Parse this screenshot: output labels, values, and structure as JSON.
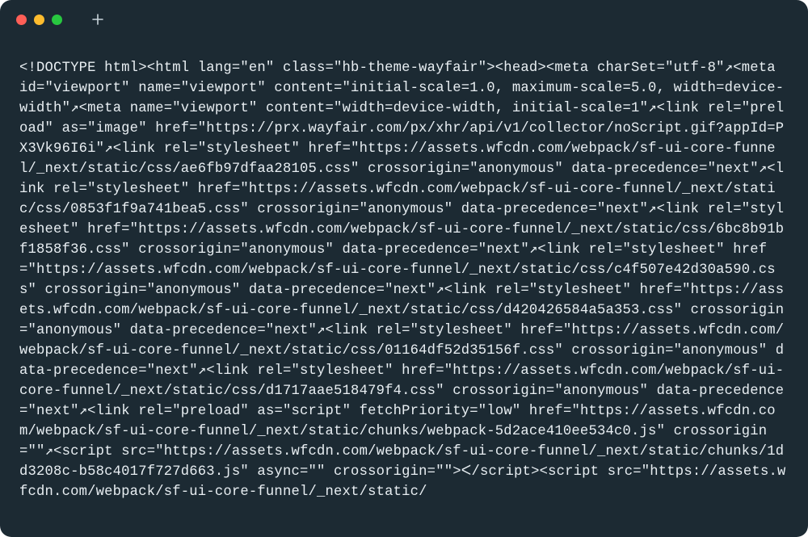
{
  "titlebar": {
    "traffic_lights": {
      "red": "#ff5f57",
      "yellow": "#febc2e",
      "green": "#28c840"
    },
    "new_tab_icon": "plus-icon"
  },
  "code_text": "<!DOCTYPE html><html lang=\"en\" class=\"hb-theme-wayfair\"><head><meta charSet=\"utf-8\"↗<meta id=\"viewport\" name=\"viewport\" content=\"initial-scale=1.0, maximum-scale=5.0, width=device-width\"↗<meta name=\"viewport\" content=\"width=device-width, initial-scale=1\"↗<link rel=\"preload\" as=\"image\" href=\"https://prx.wayfair.com/px/xhr/api/v1/collector/noScript.gif?appId=PX3Vk96I6i\"↗<link rel=\"stylesheet\" href=\"https://assets.wfcdn.com/webpack/sf-ui-core-funnel/_next/static/css/ae6fb97dfaa28105.css\" crossorigin=\"anonymous\" data-precedence=\"next\"↗<link rel=\"stylesheet\" href=\"https://assets.wfcdn.com/webpack/sf-ui-core-funnel/_next/static/css/0853f1f9a741bea5.css\" crossorigin=\"anonymous\" data-precedence=\"next\"↗<link rel=\"stylesheet\" href=\"https://assets.wfcdn.com/webpack/sf-ui-core-funnel/_next/static/css/6bc8b91bf1858f36.css\" crossorigin=\"anonymous\" data-precedence=\"next\"↗<link rel=\"stylesheet\" href=\"https://assets.wfcdn.com/webpack/sf-ui-core-funnel/_next/static/css/c4f507e42d30a590.css\" crossorigin=\"anonymous\" data-precedence=\"next\"↗<link rel=\"stylesheet\" href=\"https://assets.wfcdn.com/webpack/sf-ui-core-funnel/_next/static/css/d420426584a5a353.css\" crossorigin=\"anonymous\" data-precedence=\"next\"↗<link rel=\"stylesheet\" href=\"https://assets.wfcdn.com/webpack/sf-ui-core-funnel/_next/static/css/01164df52d35156f.css\" crossorigin=\"anonymous\" data-precedence=\"next\"↗<link rel=\"stylesheet\" href=\"https://assets.wfcdn.com/webpack/sf-ui-core-funnel/_next/static/css/d1717aae518479f4.css\" crossorigin=\"anonymous\" data-precedence=\"next\"↗<link rel=\"preload\" as=\"script\" fetchPriority=\"low\" href=\"https://assets.wfcdn.com/webpack/sf-ui-core-funnel/_next/static/chunks/webpack-5d2ace410ee534c0.js\" crossorigin=\"\"↗<script src=\"https://assets.wfcdn.com/webpack/sf-ui-core-funnel/_next/static/chunks/1dd3208c-b58c4017f727d663.js\" async=\"\" crossorigin=\"\">ᐸ/script><script src=\"https://assets.wfcdn.com/webpack/sf-ui-core-funnel/_next/static/"
}
